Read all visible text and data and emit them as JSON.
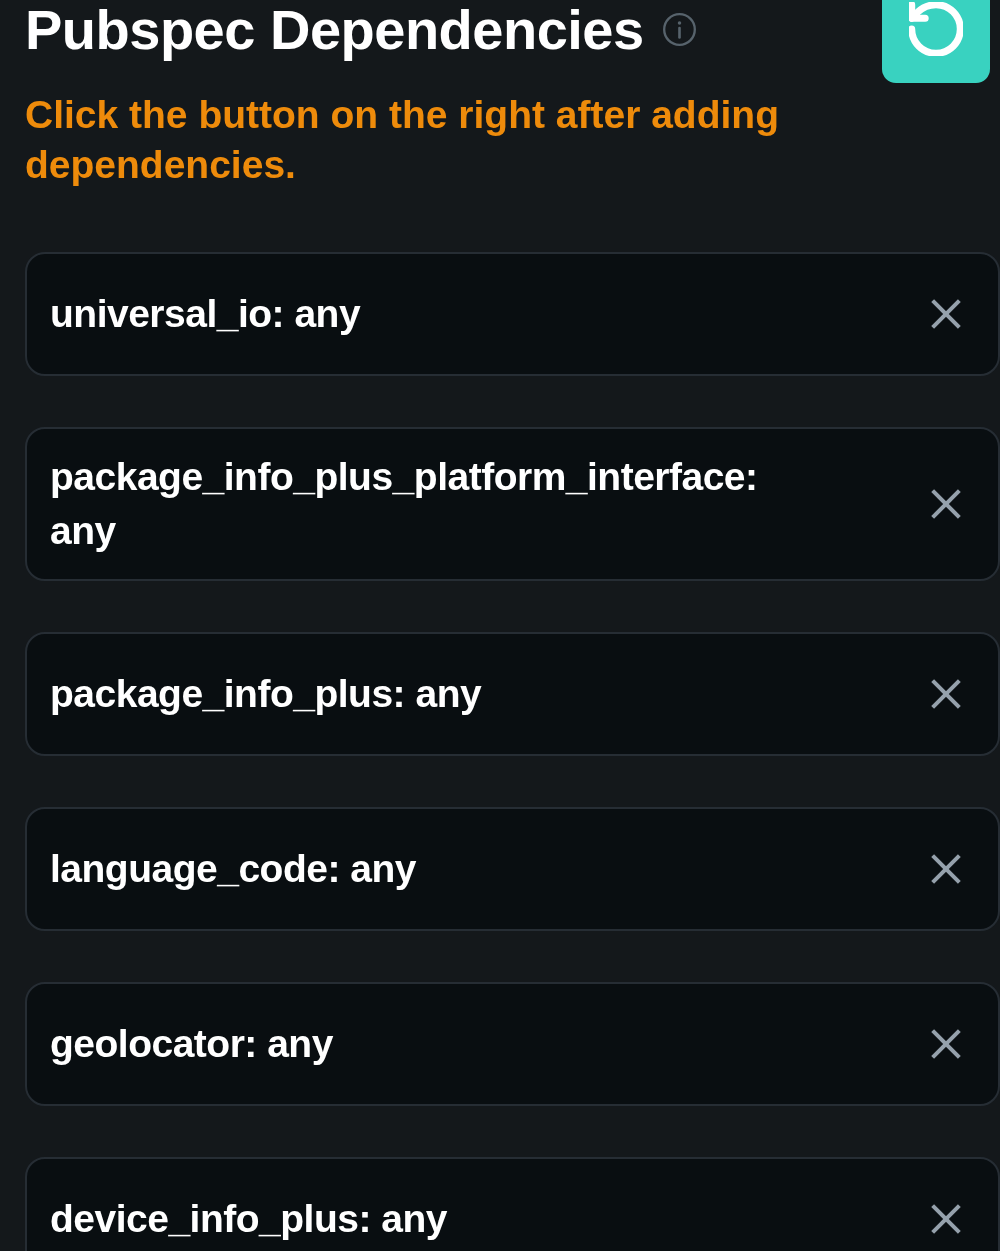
{
  "header": {
    "title": "Pubspec Dependencies",
    "hint": "Click the button on the right after adding dependencies."
  },
  "dependencies": [
    {
      "label": "universal_io: any"
    },
    {
      "label": "package_info_plus_platform_interface: any"
    },
    {
      "label": "package_info_plus: any"
    },
    {
      "label": "language_code: any"
    },
    {
      "label": "geolocator: any"
    },
    {
      "label": "device_info_plus: any"
    }
  ]
}
